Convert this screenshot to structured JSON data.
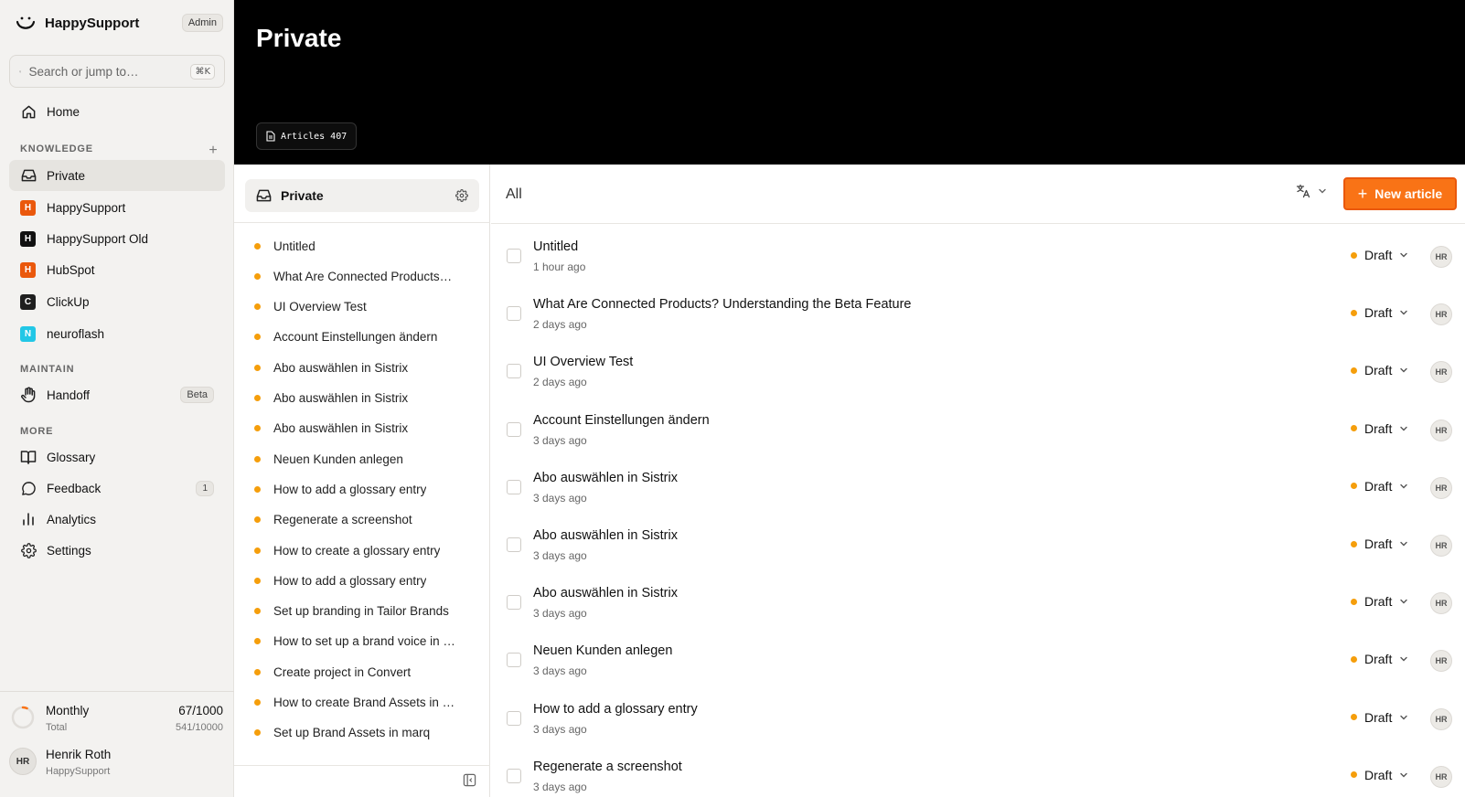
{
  "app": {
    "name": "HappySupport",
    "role_badge": "Admin"
  },
  "search": {
    "placeholder": "Search or jump to…",
    "shortcut": "⌘K"
  },
  "sidebar": {
    "home_label": "Home",
    "knowledge_label": "KNOWLEDGE",
    "knowledge_items": [
      {
        "label": "Private",
        "icon": "inbox-icon",
        "active": true
      },
      {
        "label": "HappySupport",
        "letter": "H",
        "color": "#ea580c"
      },
      {
        "label": "HappySupport Old",
        "letter": "H",
        "color": "#111111"
      },
      {
        "label": "HubSpot",
        "letter": "H",
        "color": "#ea580c"
      },
      {
        "label": "ClickUp",
        "letter": "C",
        "color": "#1f1f1f"
      },
      {
        "label": "neuroflash",
        "letter": "N",
        "color": "#22c7e6"
      }
    ],
    "maintain_label": "MAINTAIN",
    "handoff_label": "Handoff",
    "handoff_badge": "Beta",
    "more_label": "MORE",
    "glossary_label": "Glossary",
    "feedback_label": "Feedback",
    "feedback_count": "1",
    "analytics_label": "Analytics",
    "settings_label": "Settings"
  },
  "usage": {
    "title": "Monthly",
    "subtitle": "Total",
    "monthly_value": "67/1000",
    "total_value": "541/10000",
    "monthly_fraction": 0.067
  },
  "user": {
    "initials": "HR",
    "name": "Henrik Roth",
    "org": "HappySupport"
  },
  "hero": {
    "title": "Private",
    "chip_label": "Articles 407"
  },
  "collection": {
    "title": "Private",
    "items": [
      "Untitled",
      "What Are Connected Products…",
      "UI Overview Test",
      "Account Einstellungen ändern",
      "Abo auswählen in Sistrix",
      "Abo auswählen in Sistrix",
      "Abo auswählen in Sistrix",
      "Neuen Kunden anlegen",
      "How to add a glossary entry",
      "Regenerate a screenshot",
      "How to create a glossary entry",
      "How to add a glossary entry",
      "Set up branding in Tailor Brands",
      "How to set up a brand voice in …",
      "Create project in Convert",
      "How to create Brand Assets in …",
      "Set up Brand Assets in marq"
    ]
  },
  "main": {
    "filter_label": "All",
    "new_button_label": "New article",
    "accent_color": "#f97316",
    "articles": [
      {
        "title": "Untitled",
        "time": "1 hour ago",
        "status": "Draft",
        "author": "HR"
      },
      {
        "title": "What Are Connected Products? Understanding the Beta Feature",
        "time": "2 days ago",
        "status": "Draft",
        "author": "HR"
      },
      {
        "title": "UI Overview Test",
        "time": "2 days ago",
        "status": "Draft",
        "author": "HR"
      },
      {
        "title": "Account Einstellungen ändern",
        "time": "3 days ago",
        "status": "Draft",
        "author": "HR"
      },
      {
        "title": "Abo auswählen in Sistrix",
        "time": "3 days ago",
        "status": "Draft",
        "author": "HR"
      },
      {
        "title": "Abo auswählen in Sistrix",
        "time": "3 days ago",
        "status": "Draft",
        "author": "HR"
      },
      {
        "title": "Abo auswählen in Sistrix",
        "time": "3 days ago",
        "status": "Draft",
        "author": "HR"
      },
      {
        "title": "Neuen Kunden anlegen",
        "time": "3 days ago",
        "status": "Draft",
        "author": "HR"
      },
      {
        "title": "How to add a glossary entry",
        "time": "3 days ago",
        "status": "Draft",
        "author": "HR"
      },
      {
        "title": "Regenerate a screenshot",
        "time": "3 days ago",
        "status": "Draft",
        "author": "HR"
      }
    ]
  }
}
